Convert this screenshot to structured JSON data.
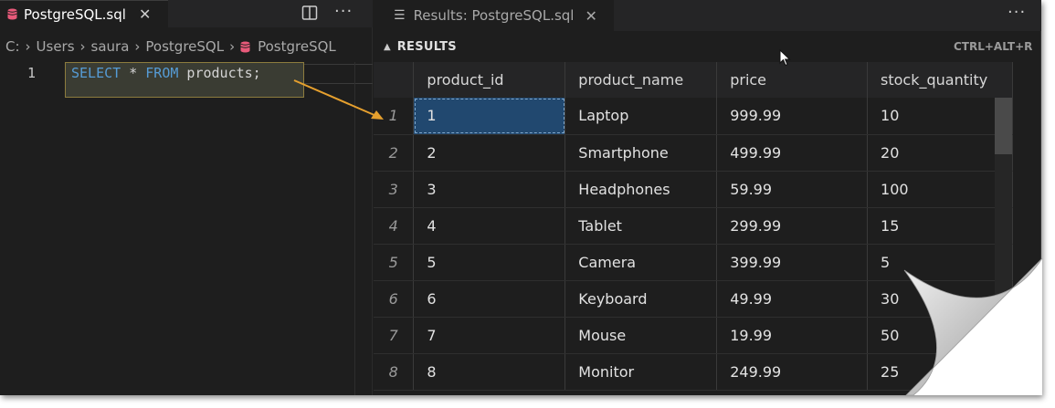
{
  "editor": {
    "tab_title": "PostgreSQL.sql",
    "tab_close": "✕",
    "more": "···",
    "breadcrumb": [
      "C:",
      "Users",
      "saura",
      "PostgreSQL",
      "PostgreSQL"
    ],
    "line_number": "1",
    "code": {
      "kw1": "SELECT",
      "star": " * ",
      "kw2": "FROM",
      "rest": " products;"
    }
  },
  "results": {
    "tab_title": "Results: PostgreSQL.sql",
    "tab_close": "✕",
    "more": "···",
    "section_title": "RESULTS",
    "shortcut": "CTRL+ALT+R",
    "columns": [
      "product_id",
      "product_name",
      "price",
      "stock_quantity"
    ],
    "rows": [
      {
        "n": "1",
        "cells": [
          "1",
          "Laptop",
          "999.99",
          "10"
        ]
      },
      {
        "n": "2",
        "cells": [
          "2",
          "Smartphone",
          "499.99",
          "20"
        ]
      },
      {
        "n": "3",
        "cells": [
          "3",
          "Headphones",
          "59.99",
          "100"
        ]
      },
      {
        "n": "4",
        "cells": [
          "4",
          "Tablet",
          "299.99",
          "15"
        ]
      },
      {
        "n": "5",
        "cells": [
          "5",
          "Camera",
          "399.99",
          "5"
        ]
      },
      {
        "n": "6",
        "cells": [
          "6",
          "Keyboard",
          "49.99",
          "30"
        ]
      },
      {
        "n": "7",
        "cells": [
          "7",
          "Mouse",
          "19.99",
          "50"
        ]
      },
      {
        "n": "8",
        "cells": [
          "8",
          "Monitor",
          "249.99",
          "25"
        ]
      }
    ],
    "selected_row": 0,
    "selected_col": 0
  },
  "colors": {
    "background": "#1e1e1e",
    "selection": "#21486f",
    "keyword": "#569cd6",
    "arrow": "#e6a02e",
    "highlight_border": "#8d7c3e"
  }
}
